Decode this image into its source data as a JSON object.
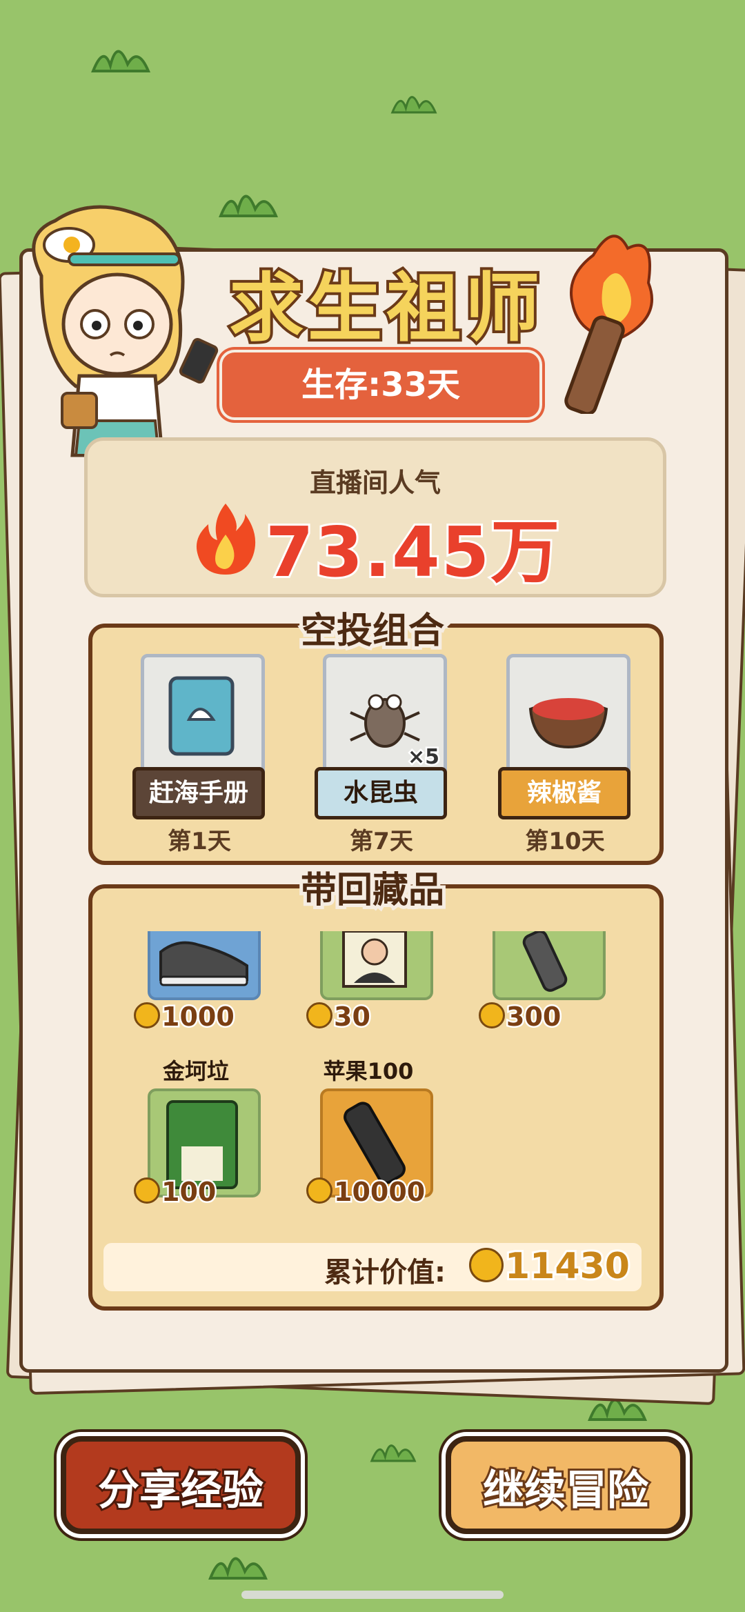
{
  "colors": {
    "background": "#98c46a",
    "title_fill": "#f5d35c",
    "badge": "#e4623d",
    "popularity_value": "#e9402c",
    "section_fill": "#f3dba6",
    "share_button": "#b33a1e",
    "continue_button": "#f2b866"
  },
  "header": {
    "title": "求生祖师",
    "survival_days": "生存:33天"
  },
  "popularity": {
    "label": "直播间人气",
    "value": "73.45万",
    "icon": "flame-icon"
  },
  "airdrop": {
    "title": "空投组合",
    "items": [
      {
        "name": "赶海手册",
        "day": "第1天",
        "icon": "book-icon",
        "qty": ""
      },
      {
        "name": "水昆虫",
        "day": "第7天",
        "icon": "water-bug-icon",
        "qty": "×5"
      },
      {
        "name": "辣椒酱",
        "day": "第10天",
        "icon": "chili-sauce-bowl-icon",
        "qty": ""
      }
    ]
  },
  "collection": {
    "title": "带回藏品",
    "items": [
      {
        "name": "",
        "price": "1000",
        "icon": "sneaker-icon"
      },
      {
        "name": "",
        "price": "30",
        "icon": "portrait-card-icon"
      },
      {
        "name": "",
        "price": "300",
        "icon": "remote-control-icon"
      },
      {
        "name": "金坷垃",
        "price": "100",
        "icon": "fertilizer-bag-icon"
      },
      {
        "name": "苹果100",
        "price": "10000",
        "icon": "phone-icon"
      }
    ],
    "total_label": "累计价值:",
    "total_value": "11430"
  },
  "buttons": {
    "share": "分享经验",
    "continue": "继续冒险"
  }
}
